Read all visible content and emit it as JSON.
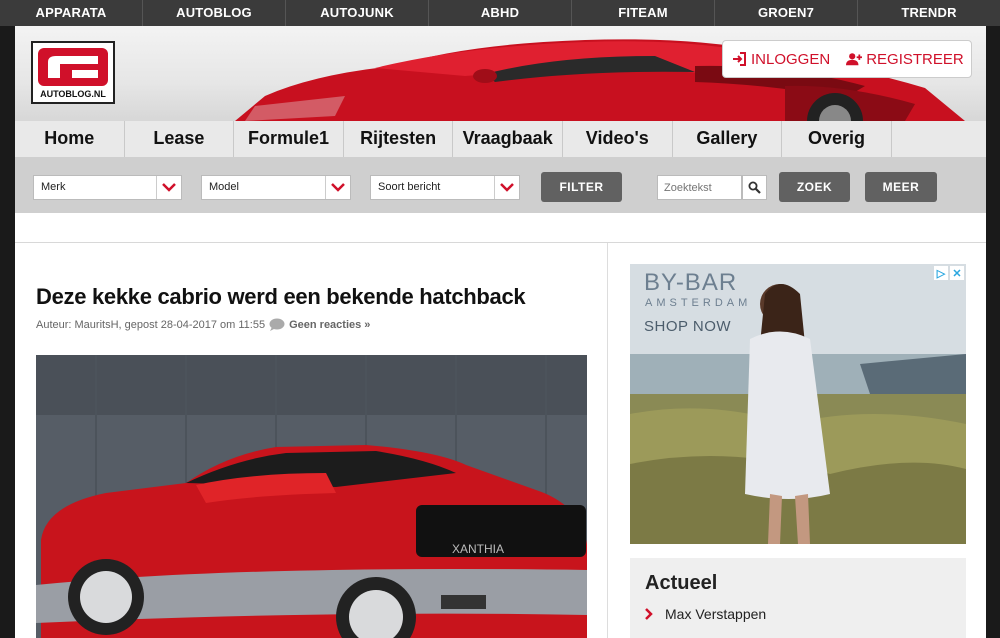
{
  "network": [
    "APPARATA",
    "AUTOBLOG",
    "AUTOJUNK",
    "ABHD",
    "FITEAM",
    "GROEN7",
    "TRENDR"
  ],
  "logo": {
    "text": "AUTOBLOG.NL"
  },
  "auth": {
    "login": "INLOGGEN",
    "register": "REGISTREER"
  },
  "nav": [
    "Home",
    "Lease",
    "Formule1",
    "Rijtesten",
    "Vraagbaak",
    "Video's",
    "Gallery",
    "Overig"
  ],
  "filters": {
    "merk": "Merk",
    "model": "Model",
    "soort": "Soort bericht",
    "filter_btn": "FILTER",
    "search_placeholder": "Zoektekst",
    "zoek_btn": "ZOEK",
    "meer_btn": "MEER"
  },
  "article": {
    "title": "Deze kekke cabrio werd een bekende hatchback",
    "meta": "Auteur: MauritsH, gepost 28-04-2017 om 11:55",
    "comments": "Geen reacties »",
    "image_plate": "XANTHIA"
  },
  "ad": {
    "brand": "BY-BAR",
    "sub": "AMSTERDAM",
    "cta": "SHOP NOW"
  },
  "actueel": {
    "heading": "Actueel",
    "items": [
      "Max Verstappen"
    ]
  },
  "colors": {
    "accent": "#d0102a",
    "netbar": "#3b3b3b",
    "nav": "#e9e9e9",
    "filterbar": "#cfcfcf",
    "button": "#616161"
  }
}
